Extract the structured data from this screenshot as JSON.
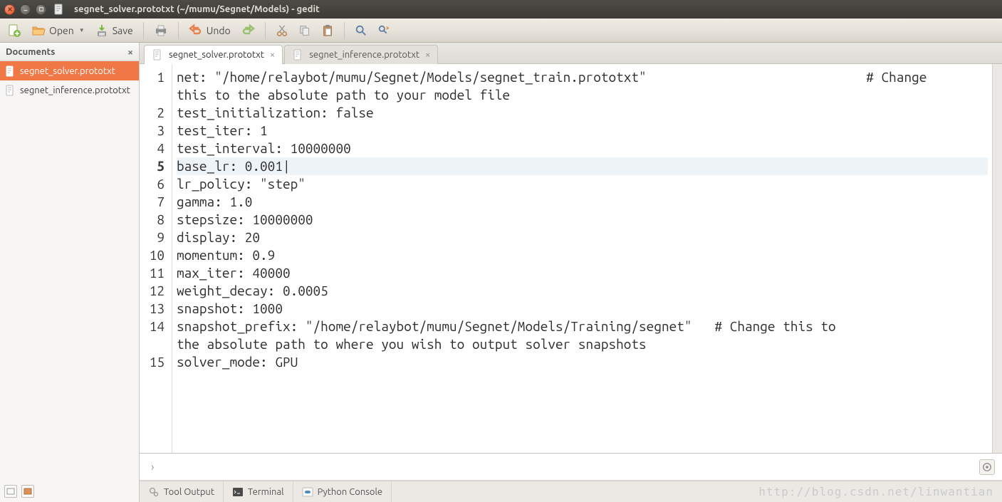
{
  "window": {
    "title": "segnet_solver.prototxt (~/mumu/Segnet/Models) - gedit"
  },
  "toolbar": {
    "open": "Open",
    "save": "Save",
    "undo": "Undo"
  },
  "sidebar": {
    "header": "Documents",
    "items": [
      {
        "label": "segnet_solver.prototxt",
        "active": true
      },
      {
        "label": "segnet_inference.prototxt",
        "active": false
      }
    ]
  },
  "tabs": [
    {
      "label": "segnet_solver.prototxt",
      "active": true
    },
    {
      "label": "segnet_inference.prototxt",
      "active": false
    }
  ],
  "editor": {
    "current_line": 5,
    "lines": [
      {
        "n": 1,
        "text": "net: \"/home/relaybot/mumu/Segnet/Models/segnet_train.prototxt\"                                           # Change this to the absolute path to your model file",
        "wrap": true
      },
      {
        "n": 2,
        "text": "test_initialization: false"
      },
      {
        "n": 3,
        "text": "test_iter: 1"
      },
      {
        "n": 4,
        "text": "test_interval: 10000000"
      },
      {
        "n": 5,
        "text": "base_lr: 0.001"
      },
      {
        "n": 6,
        "text": "lr_policy: \"step\""
      },
      {
        "n": 7,
        "text": "gamma: 1.0"
      },
      {
        "n": 8,
        "text": "stepsize: 10000000"
      },
      {
        "n": 9,
        "text": "display: 20"
      },
      {
        "n": 10,
        "text": "momentum: 0.9"
      },
      {
        "n": 11,
        "text": "max_iter: 40000"
      },
      {
        "n": 12,
        "text": "weight_decay: 0.0005"
      },
      {
        "n": 13,
        "text": "snapshot: 1000"
      },
      {
        "n": 14,
        "text": "snapshot_prefix: \"/home/relaybot/mumu/Segnet/Models/Training/segnet\"   # Change this to the absolute path to where you wish to output solver snapshots",
        "wrap": true
      },
      {
        "n": 15,
        "text": "solver_mode: GPU"
      }
    ],
    "wrapped_display": {
      "1_parts": [
        "net: \"/home/relaybot/mumu/Segnet/Models/segnet_train.prototxt\"                             # Change ",
        "this to the absolute path to your model file"
      ],
      "14_parts": [
        "snapshot_prefix: \"/home/relaybot/mumu/Segnet/Models/Training/segnet\"   # Change this to ",
        "the absolute path to where you wish to output solver snapshots"
      ]
    }
  },
  "bottom_tabs": {
    "tool_output": "Tool Output",
    "terminal": "Terminal",
    "python": "Python Console"
  },
  "watermark": "http://blog.csdn.net/linwantian"
}
